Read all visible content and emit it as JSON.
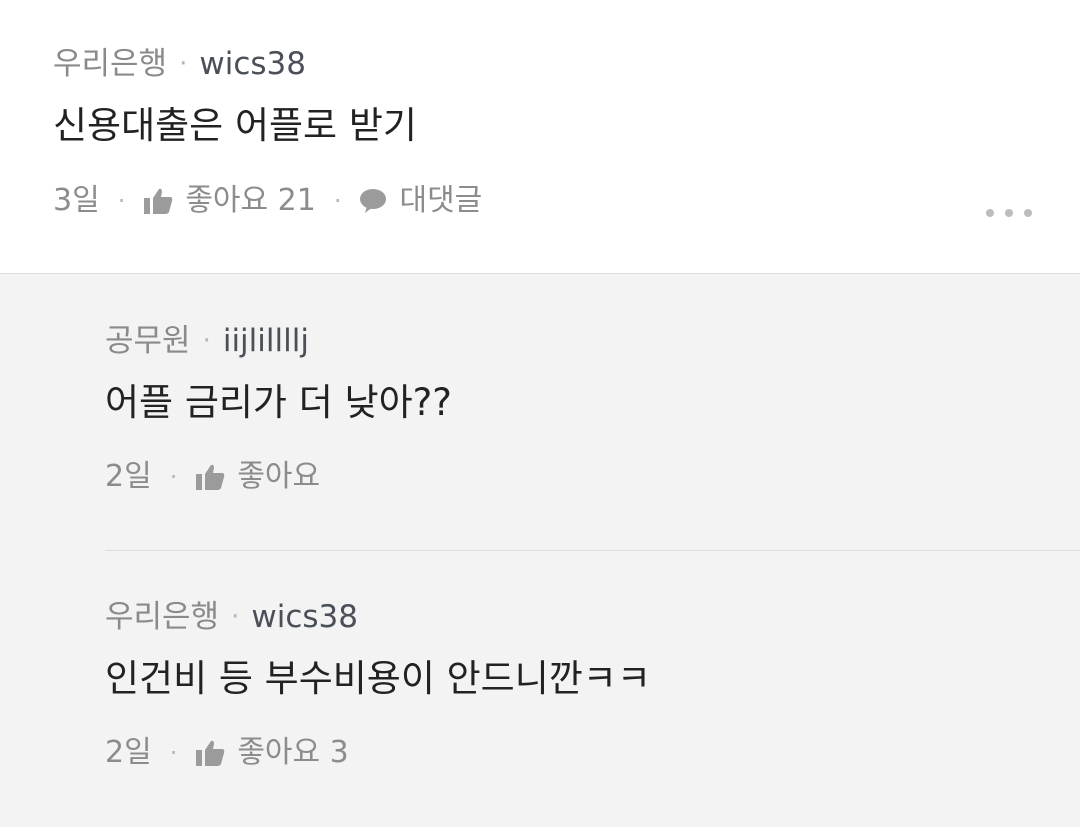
{
  "main_comment": {
    "affiliation": "우리은행",
    "separator": "·",
    "nickname": "wics38",
    "text": "신용대출은 어플로 받기",
    "age": "3일",
    "like_label": "좋아요 21",
    "reply_label": "대댓글",
    "like_icon": "thumbs-up-icon",
    "reply_icon": "speech-bubble-icon",
    "more_icon": "more-dots-icon"
  },
  "replies": [
    {
      "affiliation": "공무원",
      "separator": "·",
      "nickname": "iijlillllj",
      "text": "어플 금리가 더 낮아??",
      "age": "2일",
      "like_label": "좋아요"
    },
    {
      "affiliation": "우리은행",
      "separator": "·",
      "nickname": "wics38",
      "text": "인건비 등 부수비용이 안드니깐ㅋㅋ",
      "age": "2일",
      "like_label": "좋아요 3"
    }
  ],
  "colors": {
    "main_background": "#ffffff",
    "reply_background": "#f3f3f3",
    "text_primary": "#222222",
    "text_secondary": "#8a8a8a",
    "nickname": "#4a4f58"
  }
}
